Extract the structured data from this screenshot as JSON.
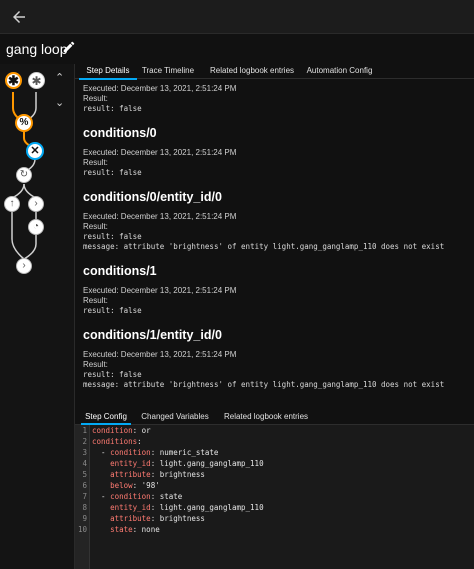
{
  "header": {
    "title": "gang loop"
  },
  "tabs": [
    {
      "label": "Step Details"
    },
    {
      "label": "Trace Timeline"
    },
    {
      "label": "Related logbook entries"
    },
    {
      "label": "Automation Config"
    }
  ],
  "trace": {
    "step0": {
      "executed": "Executed: December 13, 2021, 2:51:24 PM",
      "result_label": "Result:",
      "result": "result: false"
    },
    "h1": "conditions/0",
    "step1": {
      "executed": "Executed: December 13, 2021, 2:51:24 PM",
      "result_label": "Result:",
      "result": "result: false"
    },
    "h2": "conditions/0/entity_id/0",
    "step2": {
      "executed": "Executed: December 13, 2021, 2:51:24 PM",
      "result_label": "Result:",
      "result": "result: false",
      "message": "message: attribute 'brightness' of entity light.gang_ganglamp_110 does not exist"
    },
    "h3": "conditions/1",
    "step3": {
      "executed": "Executed: December 13, 2021, 2:51:24 PM",
      "result_label": "Result:",
      "result": "result: false"
    },
    "h4": "conditions/1/entity_id/0",
    "step4": {
      "executed": "Executed: December 13, 2021, 2:51:24 PM",
      "result_label": "Result:",
      "result": "result: false",
      "message": "message: attribute 'brightness' of entity light.gang_ganglamp_110 does not exist"
    }
  },
  "tabs2": [
    {
      "label": "Step Config"
    },
    {
      "label": "Changed Variables"
    },
    {
      "label": "Related logbook entries"
    }
  ],
  "code": {
    "line_numbers": [
      "1",
      "2",
      "3",
      "4",
      "5",
      "6",
      "7",
      "8",
      "9",
      "10"
    ],
    "l1_key": "condition",
    "l1_val": " or",
    "l2_key": "conditions",
    "l3_pre": "  - ",
    "l3_key": "condition",
    "l3_val": " numeric_state",
    "l4_pre": "    ",
    "l4_key": "entity_id",
    "l4_val": " light.gang_ganglamp_110",
    "l5_pre": "    ",
    "l5_key": "attribute",
    "l5_val": " brightness",
    "l6_pre": "    ",
    "l6_key": "below",
    "l6_val": " '98'",
    "l7_pre": "  - ",
    "l7_key": "condition",
    "l7_val": " state",
    "l8_pre": "    ",
    "l8_key": "entity_id",
    "l8_val": " light.gang_ganglamp_110",
    "l9_pre": "    ",
    "l9_key": "attribute",
    "l9_val": " brightness",
    "l10_pre": "    ",
    "l10_key": "state",
    "l10_val": " none"
  },
  "colors": {
    "accent": "#03a9f4",
    "highlight": "#ff9800",
    "background": "#111111"
  },
  "icons": [
    "back-arrow-icon",
    "pencil-icon",
    "asterisk-icon",
    "percent-icon",
    "close-icon",
    "refresh-icon",
    "arrow-up-icon",
    "chevron-right-icon",
    "timer-icon",
    "chevron-up-icon",
    "chevron-down-icon"
  ]
}
